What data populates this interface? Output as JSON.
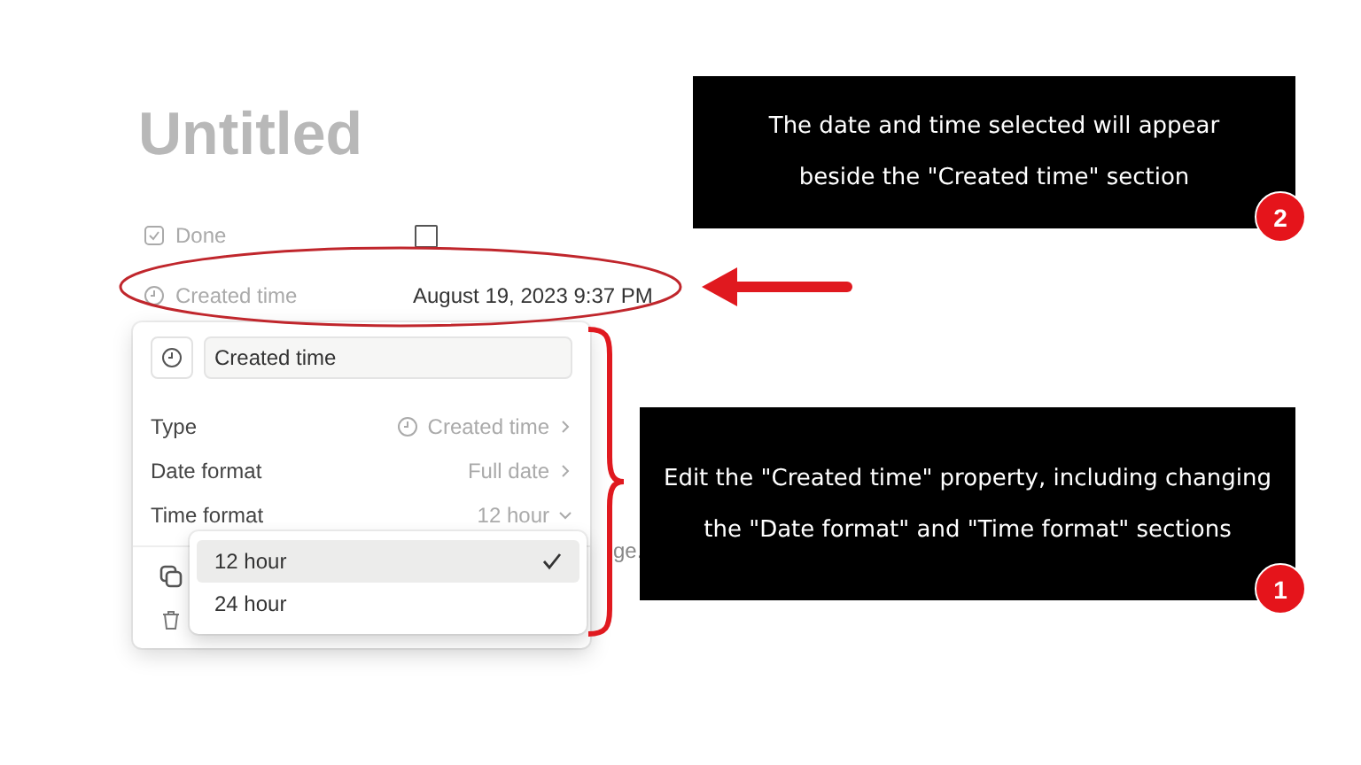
{
  "page": {
    "title": "Untitled",
    "properties": [
      {
        "kind": "checkbox",
        "label": "Done",
        "checked": false
      },
      {
        "kind": "date",
        "label": "Created time",
        "value": "August 19, 2023 9:37 PM"
      }
    ],
    "body_fragment": "ge."
  },
  "property_menu": {
    "name_value": "Created time",
    "options": [
      {
        "kind": "type",
        "label": "Type",
        "value": "Created time"
      },
      {
        "kind": "submenu",
        "label": "Date format",
        "value": "Full date"
      },
      {
        "kind": "dropdown",
        "label": "Time format",
        "value": "12 hour"
      }
    ]
  },
  "time_format_menu": {
    "options": [
      {
        "label": "12 hour",
        "selected": true
      },
      {
        "label": "24 hour",
        "selected": false
      }
    ]
  },
  "annotations": [
    {
      "text": "The date and time selected will appear beside the \"Created time\" section",
      "number": "2"
    },
    {
      "text": "Edit the \"Created time\" property, including changing the \"Date format\" and \"Time format\" sections",
      "number": "1"
    }
  ]
}
